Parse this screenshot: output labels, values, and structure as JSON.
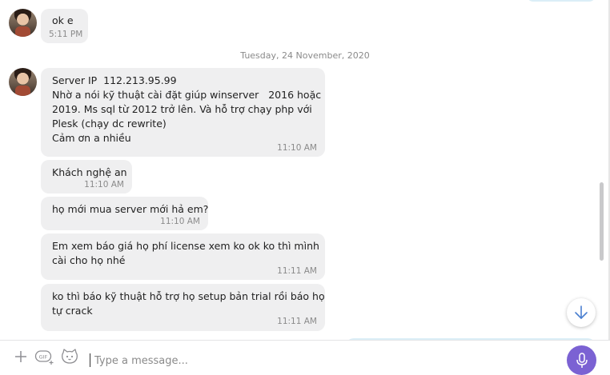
{
  "messages": [
    {
      "text": "ok e",
      "time": "5:11 PM"
    },
    {
      "text": "Server IP  112.213.95.99\nNhờ a nói kỹ thuật cài đặt giúp winserver   2016 hoặc\n2019. Ms sql từ 2012 trở lên. Và hỗ trợ chạy php với\nPlesk (chạy dc rewrite)\nCảm ơn a nhiều",
      "time": "11:10 AM"
    },
    {
      "text": "Khách nghệ an",
      "time": "11:10 AM"
    },
    {
      "text": "họ mới mua server mới hả em?",
      "time": "11:10 AM"
    },
    {
      "text": "Em xem báo giá họ phí license xem ko ok ko thì mình\ncài cho họ nhé",
      "time": "11:11 AM"
    },
    {
      "text": "ko thì báo kỹ thuật hỗ trợ họ setup bản trial rồi báo họ\ntự crack",
      "time": "11:11 AM"
    }
  ],
  "date_separator": "Tuesday, 24 November, 2020",
  "composer": {
    "placeholder": "Type a message...",
    "value": "",
    "gif_label": "GIF"
  },
  "icons": {
    "add": "plus-icon",
    "gif": "gif-icon",
    "sticker": "sticker-cat-icon",
    "mic": "microphone-icon",
    "scroll_down": "arrow-down-icon"
  },
  "colors": {
    "incoming_bubble": "#efeff0",
    "outgoing_bubble": "#dbeef7",
    "accent": "#7b62d3",
    "timestamp": "#8a8a8a"
  }
}
